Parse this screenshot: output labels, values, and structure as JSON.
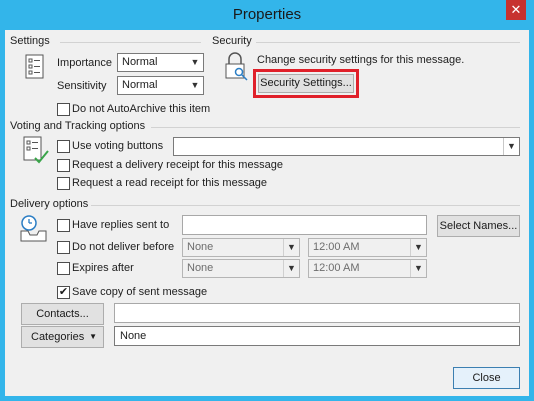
{
  "window": {
    "title": "Properties",
    "close_glyph": "✕"
  },
  "settings": {
    "section_label": "Settings",
    "importance_label": "Importance",
    "importance_value": "Normal",
    "sensitivity_label": "Sensitivity",
    "sensitivity_value": "Normal",
    "do_not_autoarchive_label": "Do not AutoArchive this item",
    "do_not_autoarchive_checked": false
  },
  "security": {
    "section_label": "Security",
    "description": "Change security settings for this message.",
    "button_label": "Security Settings..."
  },
  "voting": {
    "section_label": "Voting and Tracking options",
    "use_voting_buttons_label": "Use voting buttons",
    "use_voting_buttons_value": "",
    "delivery_receipt_label": "Request a delivery receipt for this message",
    "read_receipt_label": "Request a read receipt for this message"
  },
  "delivery": {
    "section_label": "Delivery options",
    "have_replies_label": "Have replies sent to",
    "have_replies_value": "",
    "select_names_label": "Select Names...",
    "do_not_deliver_label": "Do not deliver before",
    "do_not_deliver_date": "None",
    "do_not_deliver_time": "12:00 AM",
    "expires_after_label": "Expires after",
    "expires_after_date": "None",
    "expires_after_time": "12:00 AM",
    "save_copy_label": "Save copy of sent message",
    "save_copy_checked": true,
    "contacts_label": "Contacts...",
    "contacts_value": "",
    "categories_label": "Categories",
    "categories_value": "None"
  },
  "footer": {
    "close_label": "Close"
  },
  "icons": {
    "settings": "settings-list-icon",
    "security": "lock-key-icon",
    "voting": "voting-checklist-icon",
    "delivery": "delivery-clock-tray-icon"
  },
  "colors": {
    "window_border": "#33b5ea",
    "close_button": "#c7322f",
    "highlight": "#e0202a",
    "dialog_bg": "#f0f0f0"
  }
}
